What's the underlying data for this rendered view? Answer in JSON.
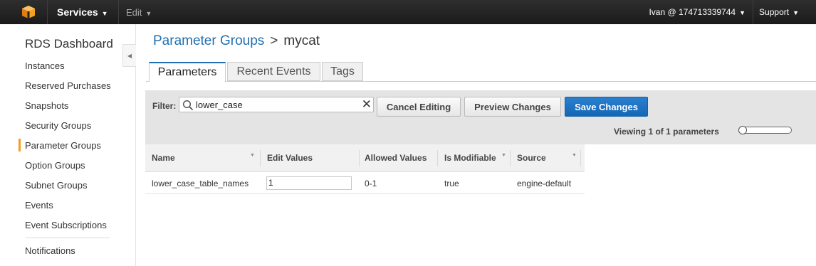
{
  "topbar": {
    "services_label": "Services",
    "edit_label": "Edit",
    "user_label": "Ivan @ 174713339744",
    "support_label": "Support"
  },
  "sidebar": {
    "title": "RDS Dashboard",
    "items": [
      {
        "label": "Instances"
      },
      {
        "label": "Reserved Purchases"
      },
      {
        "label": "Snapshots"
      },
      {
        "label": "Security Groups"
      },
      {
        "label": "Parameter Groups"
      },
      {
        "label": "Option Groups"
      },
      {
        "label": "Subnet Groups"
      },
      {
        "label": "Events"
      },
      {
        "label": "Event Subscriptions"
      },
      {
        "label": "Notifications"
      }
    ]
  },
  "breadcrumb": {
    "parent": "Parameter Groups",
    "separator": ">",
    "current": "mycat"
  },
  "tabs": [
    {
      "label": "Parameters"
    },
    {
      "label": "Recent Events"
    },
    {
      "label": "Tags"
    }
  ],
  "filter": {
    "label": "Filter:",
    "value": "lower_case"
  },
  "buttons": {
    "cancel": "Cancel Editing",
    "preview": "Preview Changes",
    "save": "Save Changes"
  },
  "viewing_text": "Viewing 1 of 1 parameters",
  "table": {
    "columns": [
      "Name",
      "Edit Values",
      "Allowed Values",
      "Is Modifiable",
      "Source"
    ],
    "rows": [
      {
        "name": "lower_case_table_names",
        "edit_value": "1",
        "allowed": "0-1",
        "modifiable": "true",
        "source": "engine-default"
      }
    ]
  },
  "colors": {
    "accent_blue": "#1f6fb0",
    "active_marker": "#f79c1b",
    "topbar": "#232323"
  }
}
